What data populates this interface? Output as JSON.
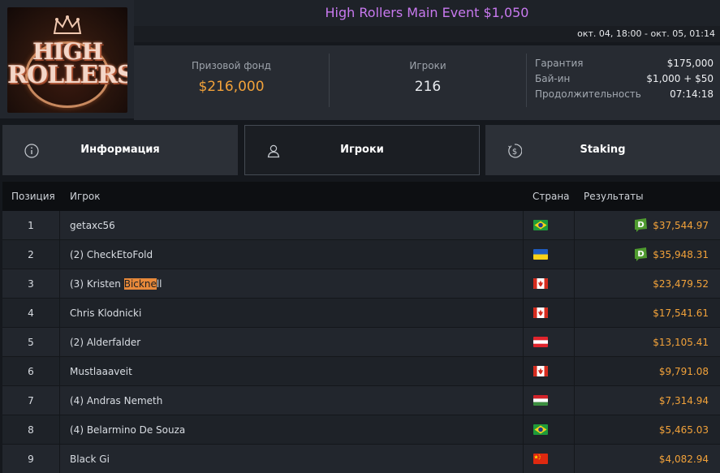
{
  "logo": {
    "line1": "HIGH",
    "line2": "ROLLERS"
  },
  "header": {
    "title": "High Rollers Main Event $1,050",
    "dates": "окт. 04, 18:00 - окт. 05, 01:14"
  },
  "stats": {
    "prize_label": "Призовой фонд",
    "prize_value": "$216,000",
    "players_label": "Игроки",
    "players_value": "216",
    "guarantee_label": "Гарантия",
    "guarantee_value": "$175,000",
    "buyin_label": "Бай-ин",
    "buyin_value": "$1,000 + $50",
    "duration_label": "Продолжительность",
    "duration_value": "07:14:18"
  },
  "tabs": {
    "info": "Информация",
    "players": "Игроки",
    "staking": "Staking"
  },
  "table": {
    "headers": {
      "position": "Позиция",
      "player": "Игрок",
      "country": "Страна",
      "results": "Результаты"
    },
    "rows": [
      {
        "position": "1",
        "name": "getaxc56",
        "country": "brazil",
        "result": "$37,544.97",
        "badge": true
      },
      {
        "position": "2",
        "name": "(2) CheckEtoFold",
        "country": "ukraine",
        "result": "$35,948.31",
        "badge": true
      },
      {
        "position": "3",
        "name_pre": "(3) Kristen ",
        "name_hl": "Bickne",
        "name_post": "ll",
        "country": "canada",
        "result": "$23,479.52",
        "badge": false
      },
      {
        "position": "4",
        "name": "Chris Klodnicki",
        "country": "canada",
        "result": "$17,541.61",
        "badge": false
      },
      {
        "position": "5",
        "name": "(2) Alderfalder",
        "country": "austria",
        "result": "$13,105.41",
        "badge": false
      },
      {
        "position": "6",
        "name": "Mustlaaaveit",
        "country": "canada",
        "result": "$9,791.08",
        "badge": false
      },
      {
        "position": "7",
        "name": "(4) Andras Nemeth",
        "country": "hungary",
        "result": "$7,314.94",
        "badge": false
      },
      {
        "position": "8",
        "name": "(4) Belarmino De Souza",
        "country": "brazil",
        "result": "$5,465.03",
        "badge": false
      },
      {
        "position": "9",
        "name": "Black Gi",
        "country": "china",
        "result": "$4,082.94",
        "badge": false
      }
    ]
  },
  "colors": {
    "title": "#c879ef",
    "accent": "#f2a23a",
    "badge": "#4f9b2f"
  }
}
